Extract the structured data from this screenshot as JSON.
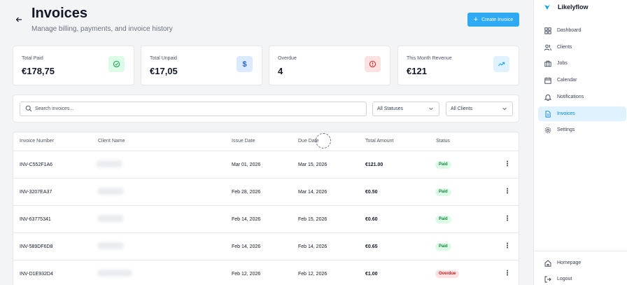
{
  "header": {
    "title": "Invoices",
    "subtitle": "Manage billing, payments, and invoice history",
    "create_label": "Create Invoice"
  },
  "stats": [
    {
      "label": "Total Paid",
      "value": "€178,75",
      "icon": "check-circle-icon",
      "color": "#16a34a",
      "bg": "#dcfce7"
    },
    {
      "label": "Total Unpaid",
      "value": "€17,05",
      "icon": "dollar-icon",
      "color": "#2563eb",
      "bg": "#dbeafe"
    },
    {
      "label": "Overdue",
      "value": "4",
      "icon": "alert-circle-icon",
      "color": "#dc2626",
      "bg": "#fee2e2"
    },
    {
      "label": "This Month Revenue",
      "value": "€121",
      "icon": "trending-up-icon",
      "color": "#0ea5e9",
      "bg": "#e0f2fe"
    }
  ],
  "filters": {
    "search_placeholder": "Search invoices...",
    "status_value": "All Statuses",
    "client_value": "All Clients"
  },
  "table": {
    "columns": [
      "Invoice Number",
      "Client Name",
      "Issue Date",
      "Due Date",
      "Total Amount",
      "Status"
    ],
    "rows": [
      {
        "number": "INV-C552F1A6",
        "issue": "Mar 01, 2026",
        "due": "Mar 15, 2026",
        "amount": "€121.00",
        "status": "Paid"
      },
      {
        "number": "INV-3207EA37",
        "issue": "Feb 28, 2026",
        "due": "Mar 14, 2026",
        "amount": "€0.50",
        "status": "Paid"
      },
      {
        "number": "INV-63775341",
        "issue": "Feb 14, 2026",
        "due": "Feb 15, 2026",
        "amount": "€0.60",
        "status": "Paid"
      },
      {
        "number": "INV-589DF6D8",
        "issue": "Feb 14, 2026",
        "due": "Feb 14, 2026",
        "amount": "€0.65",
        "status": "Paid"
      },
      {
        "number": "INV-D1E932D4",
        "issue": "Feb 12, 2026",
        "due": "Feb 12, 2026",
        "amount": "€1.00",
        "status": "Overdue"
      }
    ]
  },
  "sidebar": {
    "brand": "Likelyflow",
    "items": [
      {
        "label": "Dashboard",
        "icon": "grid-icon"
      },
      {
        "label": "Clients",
        "icon": "users-icon"
      },
      {
        "label": "Jobs",
        "icon": "briefcase-icon"
      },
      {
        "label": "Calendar",
        "icon": "calendar-icon"
      },
      {
        "label": "Notifications",
        "icon": "bell-icon"
      },
      {
        "label": "Invoices",
        "icon": "file-icon"
      },
      {
        "label": "Settings",
        "icon": "gear-icon"
      }
    ],
    "bottom_items": [
      {
        "label": "Homepage",
        "icon": "home-icon"
      },
      {
        "label": "Logout",
        "icon": "logout-icon"
      }
    ],
    "accent": "#0284c7"
  }
}
